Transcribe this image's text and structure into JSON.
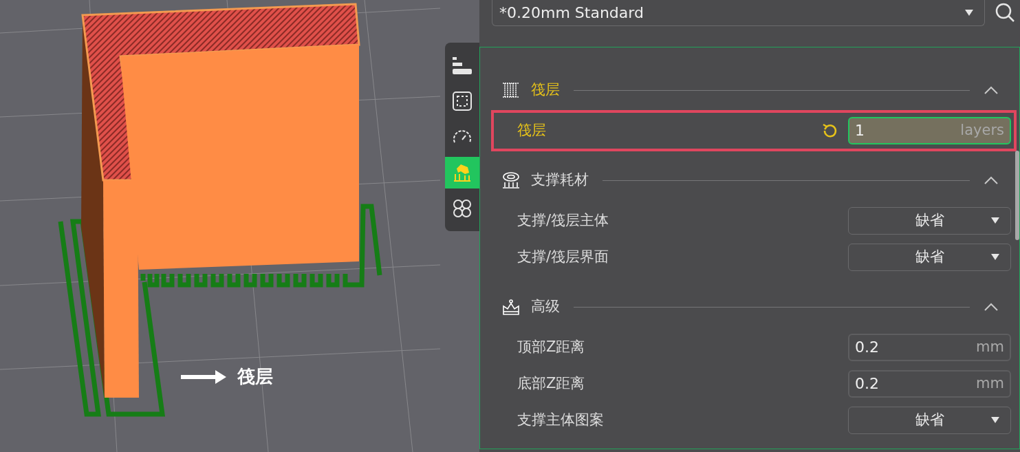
{
  "preset": {
    "value": "*0.20mm Standard"
  },
  "side_tabs": [
    {
      "kind": "quality",
      "selected": false
    },
    {
      "kind": "strength",
      "selected": false
    },
    {
      "kind": "speed",
      "selected": false
    },
    {
      "kind": "support",
      "selected": true
    },
    {
      "kind": "others",
      "selected": false
    }
  ],
  "viewport": {
    "annotation": "筏层"
  },
  "sections": [
    {
      "kind": "raft",
      "title": "筏层",
      "modified": true,
      "expanded": true,
      "rows": [
        {
          "kind": "number",
          "label": "筏层",
          "value": "1",
          "unit": "layers",
          "modified": true,
          "highlighted": true
        }
      ]
    },
    {
      "kind": "filament",
      "title": "支撑耗材",
      "modified": false,
      "expanded": true,
      "rows": [
        {
          "kind": "select",
          "label": "支撑/筏层主体",
          "value": "缺省",
          "modified": false,
          "highlighted": false
        },
        {
          "kind": "select",
          "label": "支撑/筏层界面",
          "value": "缺省",
          "modified": false,
          "highlighted": false
        }
      ]
    },
    {
      "kind": "advanced",
      "title": "高级",
      "modified": false,
      "expanded": true,
      "rows": [
        {
          "kind": "number",
          "label": "顶部Z距离",
          "value": "0.2",
          "unit": "mm",
          "modified": false,
          "highlighted": false
        },
        {
          "kind": "number",
          "label": "底部Z距离",
          "value": "0.2",
          "unit": "mm",
          "modified": false,
          "highlighted": false
        },
        {
          "kind": "select",
          "label": "支撑主体图案",
          "value": "缺省",
          "modified": false,
          "highlighted": false
        }
      ]
    }
  ]
}
